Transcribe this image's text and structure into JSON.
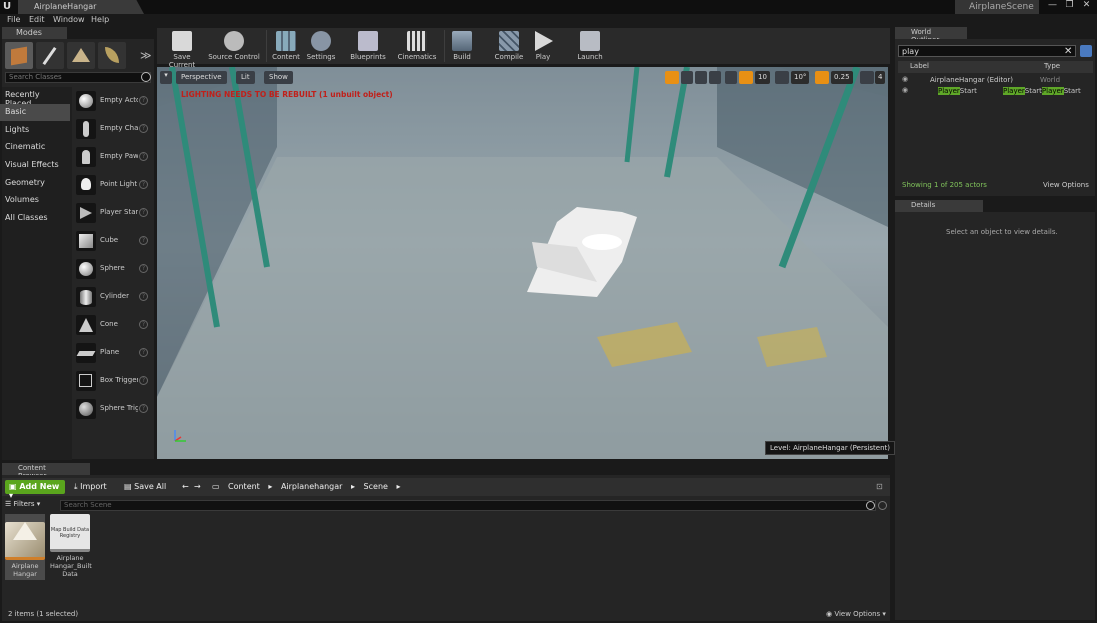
{
  "window": {
    "project_tab": "AirplaneHangar",
    "scene_tab": "AirplaneScene",
    "minimize": "—",
    "maximize": "❐",
    "close": "✕"
  },
  "menu": [
    "File",
    "Edit",
    "Window",
    "Help"
  ],
  "modes": {
    "tab_label": "Modes",
    "search_placeholder": "Search Classes",
    "categories": [
      "Recently Placed",
      "Basic",
      "Lights",
      "Cinematic",
      "Visual Effects",
      "Geometry",
      "Volumes",
      "All Classes"
    ],
    "actors": [
      "Empty Actor",
      "Empty Character",
      "Empty Pawn",
      "Point Light",
      "Player Start",
      "Cube",
      "Sphere",
      "Cylinder",
      "Cone",
      "Plane",
      "Box Trigger",
      "Sphere Trigger"
    ],
    "expand": "≫"
  },
  "toolbar": {
    "buttons": [
      "Save Current",
      "Source Control",
      "Content",
      "Settings",
      "Blueprints",
      "Cinematics",
      "Build",
      "Compile",
      "Play",
      "Launch"
    ]
  },
  "viewport": {
    "perspective": "Perspective",
    "lit": "Lit",
    "show": "Show",
    "warning": "LIGHTING NEEDS TO BE REBUILT (1 unbuilt object)",
    "level_label": "Level:",
    "level_name": "AirplaneHangar (Persistent)",
    "snap_grid": "10",
    "snap_rot": "10°",
    "snap_scale": "0.25",
    "camera_speed": "4"
  },
  "outliner": {
    "tab_label": "World Outliner",
    "search_value": "play",
    "col_label": "Label",
    "col_type": "Type",
    "rows": [
      {
        "label": "AirplaneHangar (Editor)",
        "type": "World"
      },
      {
        "label_hl": "Player",
        "label_rest": "Start",
        "type_pre": "Player",
        "type_mid": "Start",
        "type_hl": "Player",
        "type_post": "Start"
      }
    ],
    "footer": "Showing 1 of 205 actors",
    "view_options": "View Options"
  },
  "details": {
    "tab_label": "Details",
    "message": "Select an object to view details."
  },
  "content_browser": {
    "tab_label": "Content Browser",
    "add_new": "Add New",
    "import": "Import",
    "save_all": "Save All",
    "path": [
      "Content",
      "Airplanehangar",
      "Scene"
    ],
    "filters": "Filters",
    "search_placeholder": "Search Scene",
    "assets": [
      {
        "label": "Airplane Hangar",
        "thumb_text": ""
      },
      {
        "label": "Airplane Hangar_Built Data",
        "thumb_text": "Map Build Data Registry"
      }
    ],
    "status": "2 items (1 selected)",
    "view_options": "View Options"
  }
}
